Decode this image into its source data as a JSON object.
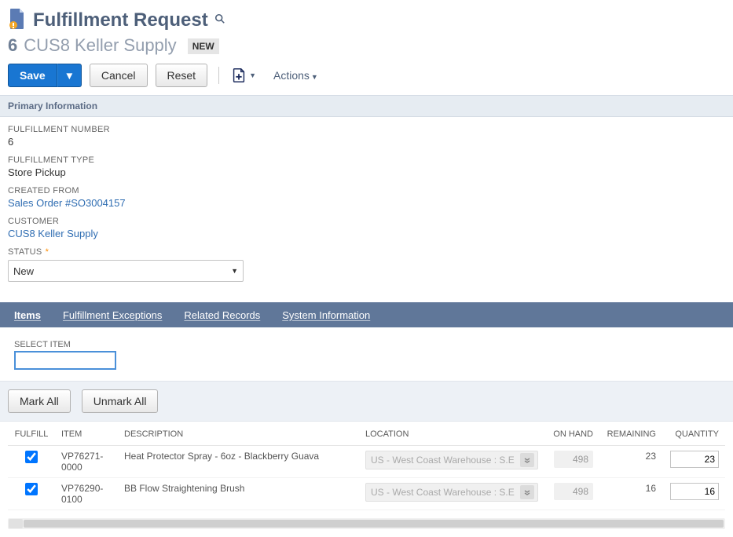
{
  "header": {
    "title": "Fulfillment Request",
    "record_id": "6",
    "record_name": "CUS8 Keller Supply",
    "status_badge": "NEW"
  },
  "actions": {
    "save": "Save",
    "cancel": "Cancel",
    "reset": "Reset",
    "actions_menu": "Actions"
  },
  "section": {
    "primary_info_title": "Primary Information"
  },
  "fields": {
    "fulfillment_number": {
      "label": "FULFILLMENT NUMBER",
      "value": "6"
    },
    "fulfillment_type": {
      "label": "FULFILLMENT TYPE",
      "value": "Store Pickup"
    },
    "created_from": {
      "label": "CREATED FROM",
      "value": "Sales Order #SO3004157"
    },
    "customer": {
      "label": "CUSTOMER",
      "value": "CUS8 Keller Supply"
    },
    "status": {
      "label": "STATUS",
      "value": "New"
    }
  },
  "tabs": {
    "items": "Items",
    "fulfillment_exceptions": "Fulfillment Exceptions",
    "related_records": "Related Records",
    "system_information": "System Information"
  },
  "sublist": {
    "select_item_label": "SELECT ITEM",
    "select_item_value": "",
    "mark_all": "Mark All",
    "unmark_all": "Unmark All",
    "columns": {
      "fulfill": "FULFILL",
      "item": "ITEM",
      "description": "DESCRIPTION",
      "location": "LOCATION",
      "on_hand": "ON HAND",
      "remaining": "REMAINING",
      "quantity": "QUANTITY"
    },
    "location_display": "US - West Coast Warehouse : S.E",
    "rows": [
      {
        "fulfill": true,
        "item": "VP76271-0000",
        "description": "Heat Protector Spray - 6oz - Blackberry Guava",
        "on_hand": "498",
        "remaining": "23",
        "quantity": "23"
      },
      {
        "fulfill": true,
        "item": "VP76290-0100",
        "description": "BB Flow Straightening Brush",
        "on_hand": "498",
        "remaining": "16",
        "quantity": "16"
      }
    ]
  }
}
